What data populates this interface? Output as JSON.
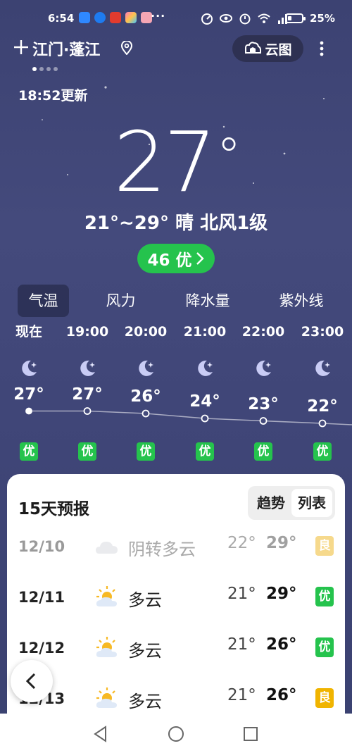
{
  "status_bar": {
    "time": "6:54",
    "overflow": "···",
    "battery_pct": "25%",
    "battery_level": 0.25
  },
  "header": {
    "city": "江门·蓬江",
    "cloud_button": "云图"
  },
  "updated": "18:52更新",
  "current": {
    "temp": "27",
    "summary": "21°~29° 晴 北风1级",
    "aqi": "46 优",
    "aqi_color": "#25c34d"
  },
  "tabs": [
    "气温",
    "风力",
    "降水量",
    "紫外线"
  ],
  "hourly": [
    {
      "time": "现在",
      "temp": "27°",
      "aqi": "优",
      "value": 27
    },
    {
      "time": "19:00",
      "temp": "27°",
      "aqi": "优",
      "value": 27
    },
    {
      "time": "20:00",
      "temp": "26°",
      "aqi": "优",
      "value": 26
    },
    {
      "time": "21:00",
      "temp": "24°",
      "aqi": "优",
      "value": 24
    },
    {
      "time": "22:00",
      "temp": "23°",
      "aqi": "优",
      "value": 23
    },
    {
      "time": "23:00",
      "temp": "22°",
      "aqi": "优",
      "value": 22
    }
  ],
  "forecast": {
    "title": "15天预报",
    "toggle": [
      "趋势",
      "列表"
    ],
    "rows": [
      {
        "date": "12/10",
        "icon": "overcast-cloud-icon",
        "cond": "阴转多云",
        "lo": "22°",
        "hi": "29°",
        "aqi": "良",
        "aqi_color": "#f6d98c"
      },
      {
        "date": "12/11",
        "icon": "partly-cloudy-icon",
        "cond": "多云",
        "lo": "21°",
        "hi": "29°",
        "aqi": "优",
        "aqi_color": "#25c34d"
      },
      {
        "date": "12/12",
        "icon": "partly-cloudy-icon",
        "cond": "多云",
        "lo": "21°",
        "hi": "26°",
        "aqi": "优",
        "aqi_color": "#25c34d"
      },
      {
        "date": "12/13",
        "icon": "partly-cloudy-icon",
        "cond": "多云",
        "lo": "21°",
        "hi": "26°",
        "aqi": "良",
        "aqi_color": "#f0b400"
      }
    ]
  }
}
